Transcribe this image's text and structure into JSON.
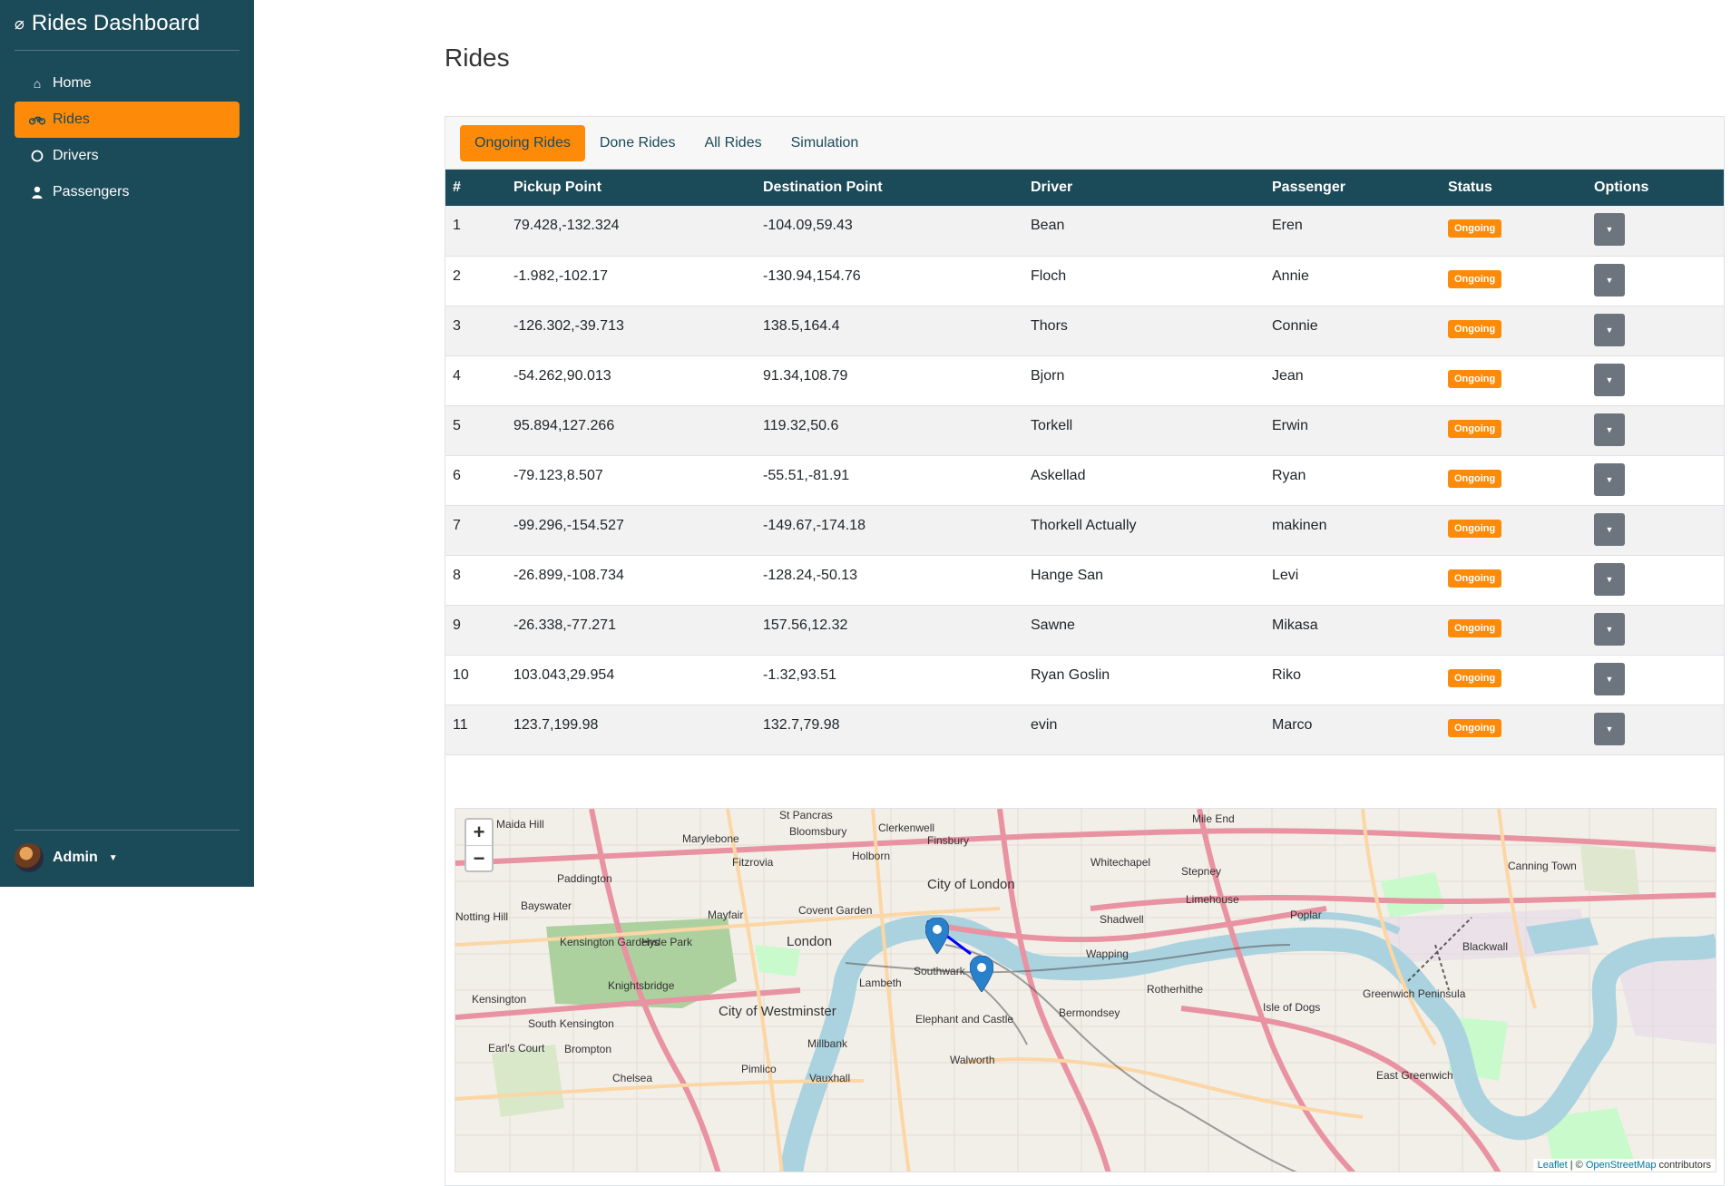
{
  "app": {
    "title": "Rides Dashboard"
  },
  "sidebar": {
    "items": [
      {
        "label": "Home",
        "icon": "home-icon"
      },
      {
        "label": "Rides",
        "icon": "motorcycle-icon"
      },
      {
        "label": "Drivers",
        "icon": "circle-icon"
      },
      {
        "label": "Passengers",
        "icon": "user-icon"
      }
    ],
    "active": "Rides",
    "user": {
      "name": "Admin"
    }
  },
  "page": {
    "title": "Rides"
  },
  "tabs": [
    {
      "label": "Ongoing Rides",
      "active": true
    },
    {
      "label": "Done Rides",
      "active": false
    },
    {
      "label": "All Rides",
      "active": false
    },
    {
      "label": "Simulation",
      "active": false
    }
  ],
  "table": {
    "headers": [
      "#",
      "Pickup Point",
      "Destination Point",
      "Driver",
      "Passenger",
      "Status",
      "Options"
    ],
    "rows": [
      [
        "1",
        "79.428,-132.324",
        "-104.09,59.43",
        "Bean",
        "Eren",
        "Ongoing"
      ],
      [
        "2",
        "-1.982,-102.17",
        "-130.94,154.76",
        "Floch",
        "Annie",
        "Ongoing"
      ],
      [
        "3",
        "-126.302,-39.713",
        "138.5,164.4",
        "Thors",
        "Connie",
        "Ongoing"
      ],
      [
        "4",
        "-54.262,90.013",
        "91.34,108.79",
        "Bjorn",
        "Jean",
        "Ongoing"
      ],
      [
        "5",
        "95.894,127.266",
        "119.32,50.6",
        "Torkell",
        "Erwin",
        "Ongoing"
      ],
      [
        "6",
        "-79.123,8.507",
        "-55.51,-81.91",
        "Askellad",
        "Ryan",
        "Ongoing"
      ],
      [
        "7",
        "-99.296,-154.527",
        "-149.67,-174.18",
        "Thorkell Actually",
        "makinen",
        "Ongoing"
      ],
      [
        "8",
        "-26.899,-108.734",
        "-128.24,-50.13",
        "Hange San",
        "Levi",
        "Ongoing"
      ],
      [
        "9",
        "-26.338,-77.271",
        "157.56,12.32",
        "Sawne",
        "Mikasa",
        "Ongoing"
      ],
      [
        "10",
        "103.043,29.954",
        "-1.32,93.51",
        "Ryan Goslin",
        "Riko",
        "Ongoing"
      ],
      [
        "11",
        "123.7,199.98",
        "132.7,79.98",
        "evin",
        "Marco",
        "Ongoing"
      ]
    ]
  },
  "map": {
    "zoom_in": "+",
    "zoom_out": "−",
    "attribution": {
      "leaflet": "Leaflet",
      "sep": " | © ",
      "osm": "OpenStreetMap",
      "suffix": " contributors"
    },
    "labels": [
      "St Pancras",
      "Clerkenwell",
      "Mile End",
      "Maida Hill",
      "Marylebone",
      "Bloomsbury",
      "Finsbury",
      "Whitechapel",
      "Stepney",
      "Canning Town",
      "Fitzrovia",
      "Holborn",
      "Paddington",
      "City of London",
      "Limehouse",
      "Bayswater",
      "Mayfair",
      "Covent Garden",
      "Shadwell",
      "Poplar",
      "London",
      "Blackwall",
      "Kensington Gardens",
      "Hyde Park",
      "Southwark",
      "Wapping",
      "Knightsbridge",
      "Lambeth",
      "Rotherhithe",
      "City of Westminster",
      "Kensington",
      "Greenwich Peninsula",
      "Isle of Dogs",
      "South Kensington",
      "Elephant and Castle",
      "Bermondsey",
      "Earl's Court",
      "Brompton",
      "Millbank",
      "Walworth",
      "Pimlico",
      "Chelsea",
      "Vauxhall",
      "East Greenwich",
      "Notting Hill"
    ]
  },
  "colors": {
    "sidebar": "#1b4a58",
    "accent": "#fd8b09",
    "route": "#0000ff"
  }
}
